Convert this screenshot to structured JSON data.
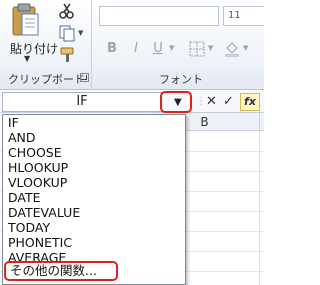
{
  "ribbon": {
    "clipboard": {
      "paste_label": "貼り付け",
      "group_label": "クリップボード"
    },
    "font": {
      "font_name": "",
      "font_size": "11",
      "group_label": "フォント"
    },
    "formatting": [
      "B",
      "I",
      "U"
    ]
  },
  "formula_bar": {
    "name_box_value": "IF",
    "fx_label": "fx"
  },
  "grid": {
    "column_b": "B"
  },
  "function_list": {
    "items": [
      "IF",
      "AND",
      "CHOOSE",
      "HLOOKUP",
      "VLOOKUP",
      "DATE",
      "DATEVALUE",
      "TODAY",
      "PHONETIC",
      "AVERAGE"
    ],
    "more_functions": "その他の関数..."
  },
  "colors": {
    "highlight": "#e0201b",
    "fx_background": "#fff7c7"
  }
}
